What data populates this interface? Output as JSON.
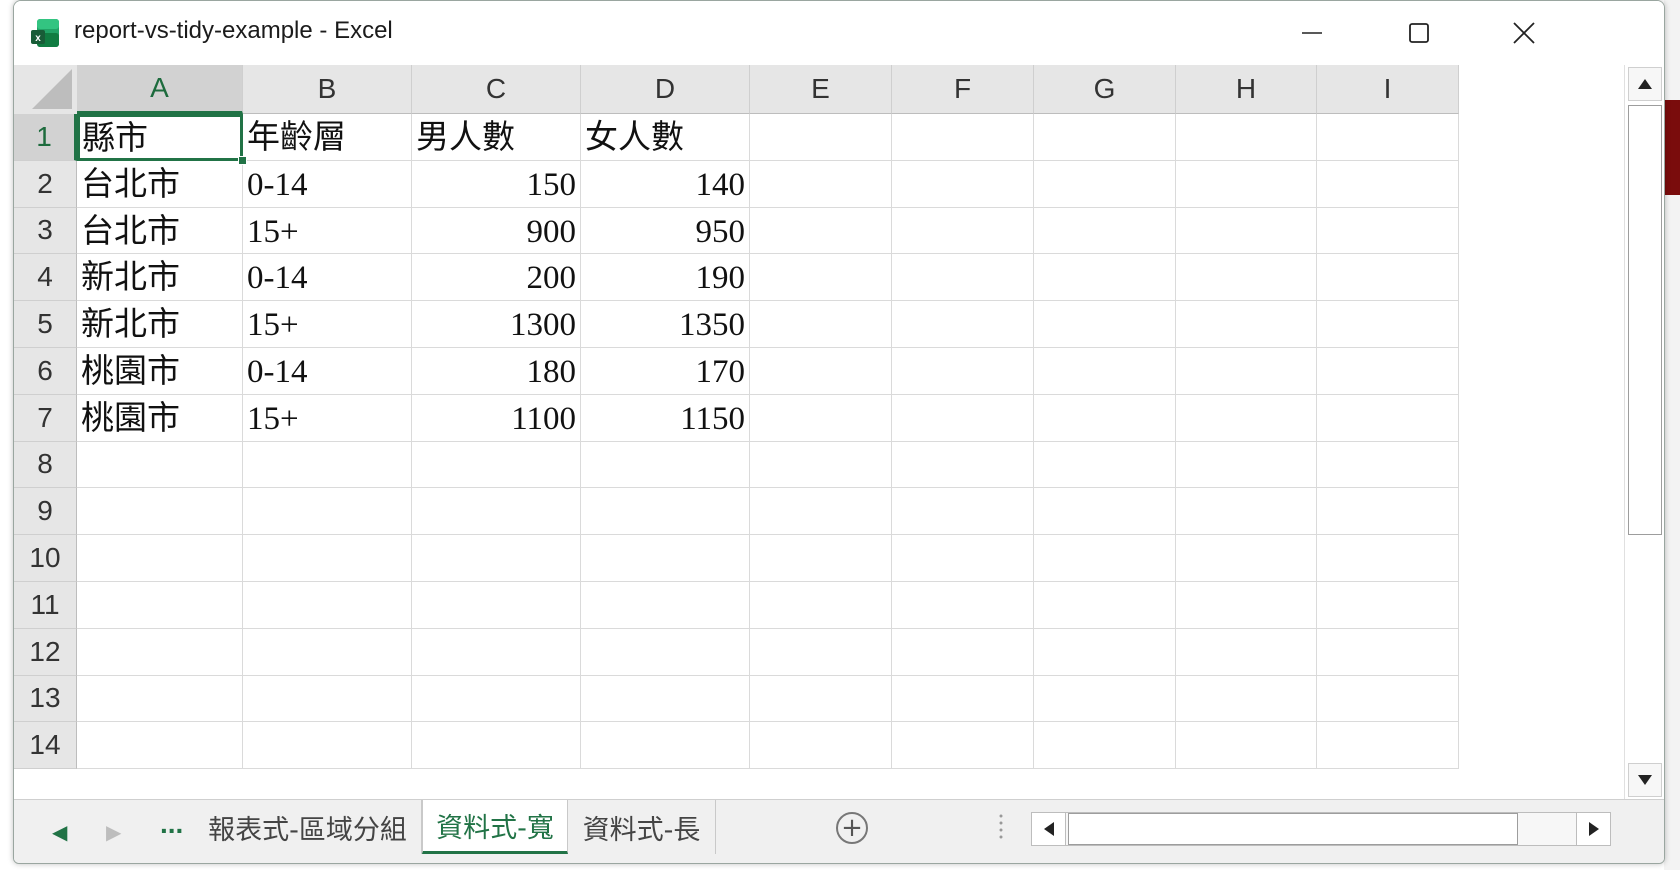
{
  "window": {
    "title": "report-vs-tidy-example - Excel",
    "controls": [
      "minimize-icon",
      "maximize-icon",
      "close-icon"
    ]
  },
  "columns": [
    "A",
    "B",
    "C",
    "D",
    "E",
    "F",
    "G",
    "H",
    "I"
  ],
  "rows": [
    "1",
    "2",
    "3",
    "4",
    "5",
    "6",
    "7",
    "8",
    "9",
    "10",
    "11",
    "12",
    "13",
    "14"
  ],
  "active_cell": "A1",
  "table": {
    "header": [
      "縣市",
      "年齡層",
      "男人數",
      "女人數"
    ],
    "data": [
      [
        "台北市",
        "0-14",
        "150",
        "140"
      ],
      [
        "台北市",
        "15+",
        "900",
        "950"
      ],
      [
        "新北市",
        "0-14",
        "200",
        "190"
      ],
      [
        "新北市",
        "15+",
        "1300",
        "1350"
      ],
      [
        "桃園市",
        "0-14",
        "180",
        "170"
      ],
      [
        "桃園市",
        "15+",
        "1100",
        "1150"
      ]
    ]
  },
  "sheet_tabs": {
    "ellipsis": "...",
    "tabs": [
      "報表式-區域分組",
      "資料式-寬",
      "資料式-長"
    ],
    "active": "資料式-寬",
    "add_icon": "plus-circle-icon"
  },
  "colors": {
    "accent": "#217346",
    "header_bg": "#e6e6e6",
    "grid_line": "#dadada"
  }
}
